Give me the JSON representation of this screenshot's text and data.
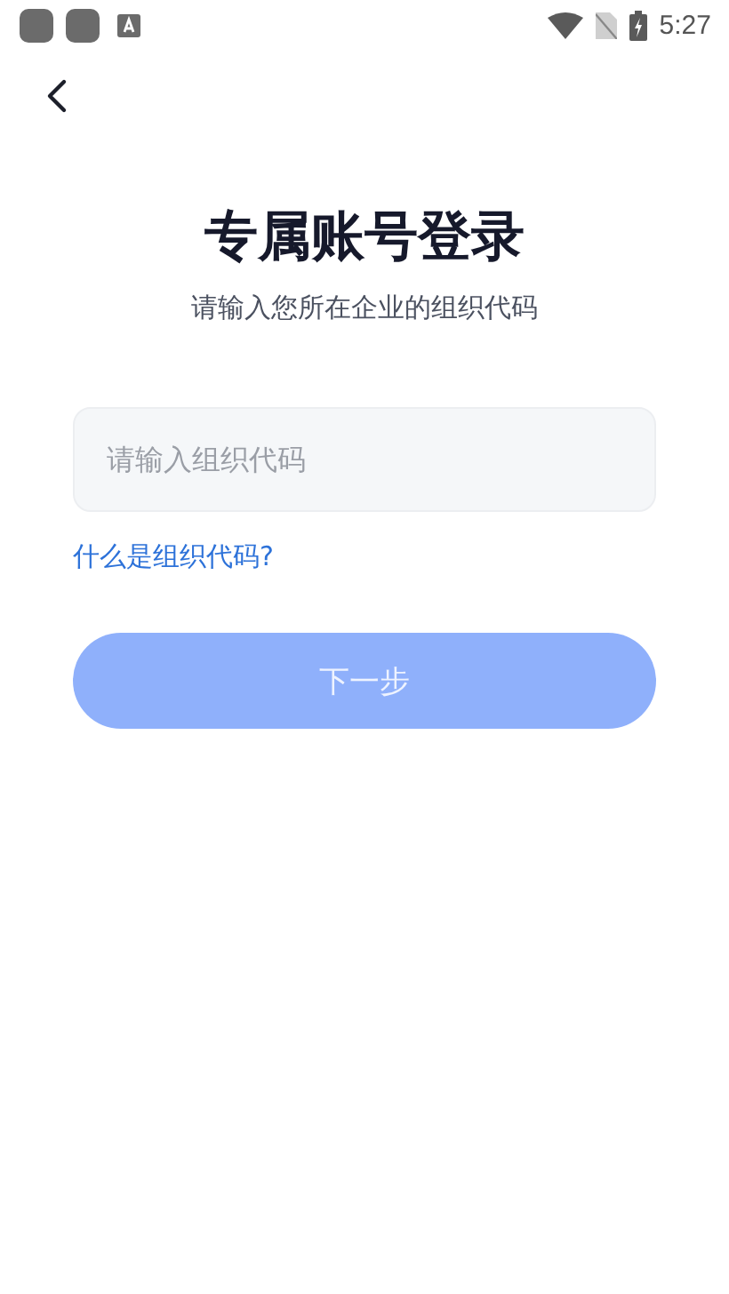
{
  "status_bar": {
    "time": "5:27"
  },
  "title": "专属账号登录",
  "subtitle": "请输入您所在企业的组织代码",
  "org_code_field": {
    "placeholder": "请输入组织代码"
  },
  "help_link": "什么是组织代码?",
  "next_button": {
    "label": "下一步",
    "disabled": true
  }
}
